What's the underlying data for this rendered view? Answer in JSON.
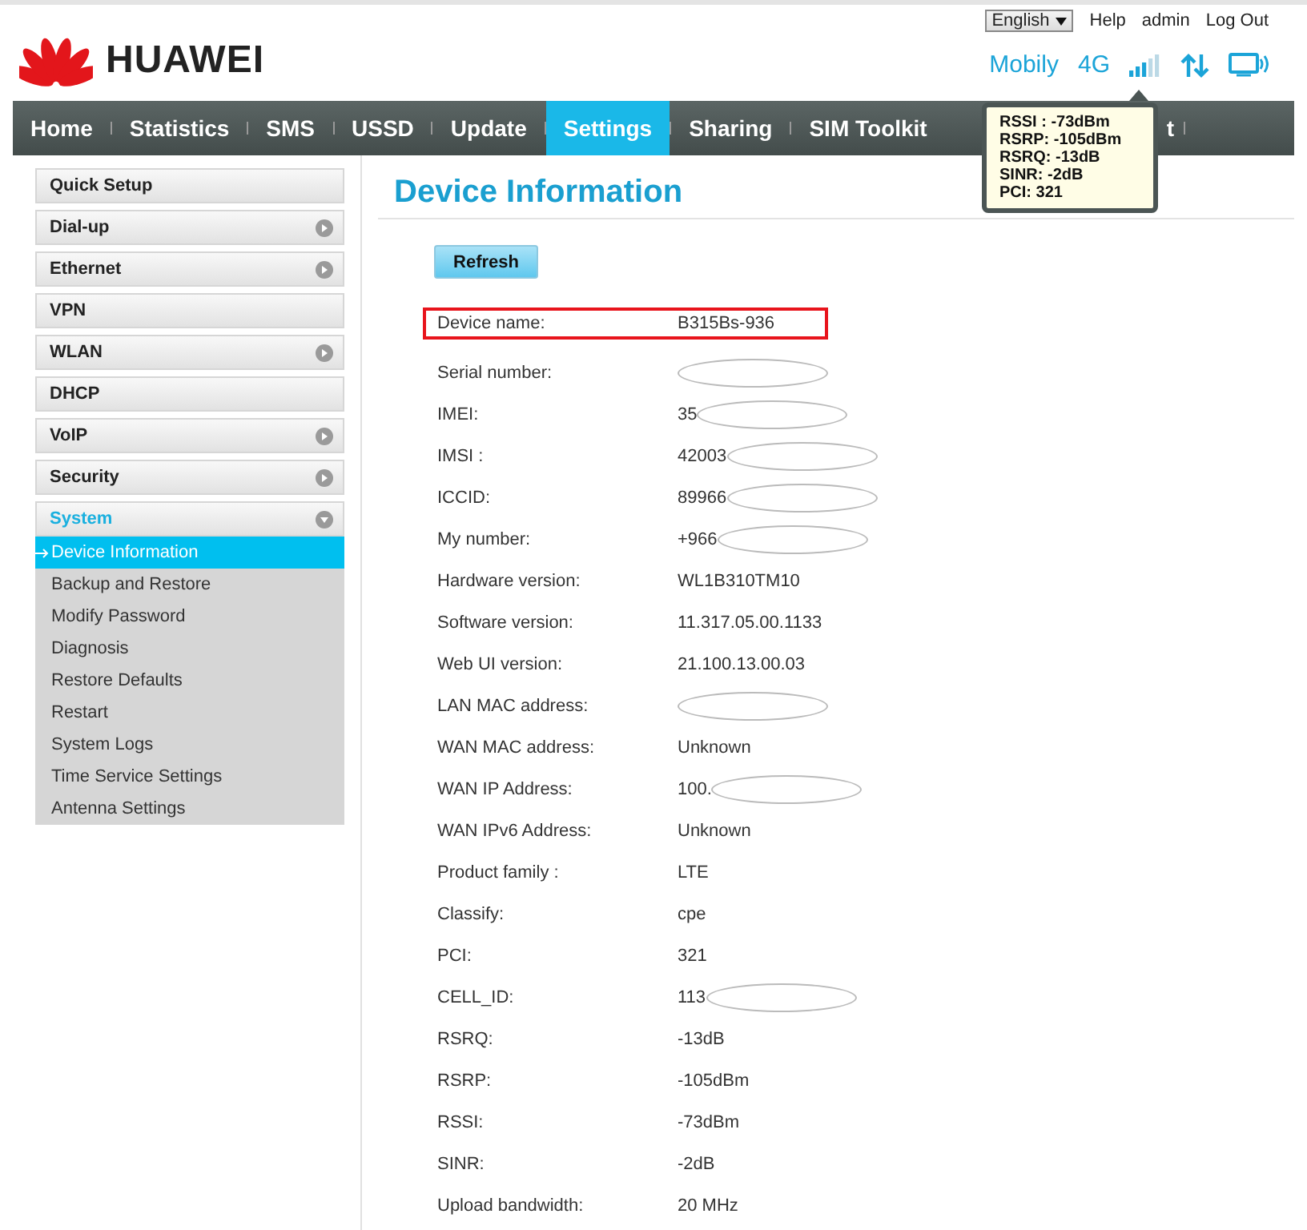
{
  "header": {
    "logo": "HUAWEI",
    "language": "English",
    "links": [
      "Help",
      "admin",
      "Log Out"
    ],
    "operator": "Mobily",
    "network": "4G"
  },
  "nav": [
    {
      "label": "Home",
      "selected": false
    },
    {
      "label": "Statistics",
      "selected": false
    },
    {
      "label": "SMS",
      "selected": false
    },
    {
      "label": "USSD",
      "selected": false
    },
    {
      "label": "Update",
      "selected": false
    },
    {
      "label": "Settings",
      "selected": true
    },
    {
      "label": "Sharing",
      "selected": false
    },
    {
      "label": "SIM Toolkit",
      "selected": false
    },
    {
      "label": "t",
      "selected": false
    }
  ],
  "signal_tooltip": [
    "RSSI : -73dBm",
    "RSRP: -105dBm",
    "RSRQ: -13dB",
    "SINR: -2dB",
    "PCI: 321"
  ],
  "sidebar": [
    {
      "label": "Quick Setup",
      "expandable": false,
      "expanded": false
    },
    {
      "label": "Dial-up",
      "expandable": true,
      "expanded": false
    },
    {
      "label": "Ethernet",
      "expandable": true,
      "expanded": false
    },
    {
      "label": "VPN",
      "expandable": false,
      "expanded": false
    },
    {
      "label": "WLAN",
      "expandable": true,
      "expanded": false
    },
    {
      "label": "DHCP",
      "expandable": false,
      "expanded": false
    },
    {
      "label": "VoIP",
      "expandable": true,
      "expanded": false
    },
    {
      "label": "Security",
      "expandable": true,
      "expanded": false
    },
    {
      "label": "System",
      "expandable": true,
      "expanded": true,
      "children": [
        {
          "label": "Device Information",
          "selected": true
        },
        {
          "label": "Backup and Restore",
          "selected": false
        },
        {
          "label": "Modify Password",
          "selected": false
        },
        {
          "label": "Diagnosis",
          "selected": false
        },
        {
          "label": "Restore Defaults",
          "selected": false
        },
        {
          "label": "Restart",
          "selected": false
        },
        {
          "label": "System Logs",
          "selected": false
        },
        {
          "label": "Time Service Settings",
          "selected": false
        },
        {
          "label": "Antenna Settings",
          "selected": false
        }
      ]
    }
  ],
  "page": {
    "title": "Device Information",
    "refresh_button": "Refresh",
    "rows": [
      {
        "label": "Device name:",
        "value": "B315Bs-936",
        "highlighted": true,
        "redacted": false
      },
      {
        "label": "Serial number:",
        "redacted": true,
        "highlighted": false
      },
      {
        "label": "IMEI:",
        "value": "35",
        "redacted": true,
        "highlighted": false
      },
      {
        "label": "IMSI :",
        "value": "42003",
        "redacted": true,
        "highlighted": false
      },
      {
        "label": "ICCID:",
        "value": "89966",
        "redacted": true,
        "highlighted": false
      },
      {
        "label": "My number:",
        "value": "+966",
        "redacted": true,
        "highlighted": false
      },
      {
        "label": "Hardware version:",
        "value": "WL1B310TM10",
        "redacted": false,
        "highlighted": false
      },
      {
        "label": "Software version:",
        "value": "11.317.05.00.1133",
        "redacted": false,
        "highlighted": false
      },
      {
        "label": "Web UI version:",
        "value": "21.100.13.00.03",
        "redacted": false,
        "highlighted": false
      },
      {
        "label": "LAN MAC address:",
        "redacted": true,
        "highlighted": false
      },
      {
        "label": "WAN MAC address:",
        "value": "Unknown",
        "redacted": false,
        "highlighted": false
      },
      {
        "label": "WAN IP Address:",
        "value": "100.",
        "redacted": true,
        "highlighted": false
      },
      {
        "label": "WAN IPv6 Address:",
        "value": "Unknown",
        "redacted": false,
        "highlighted": false
      },
      {
        "label": "Product family :",
        "value": "LTE",
        "redacted": false,
        "highlighted": false
      },
      {
        "label": "Classify:",
        "value": "cpe",
        "redacted": false,
        "highlighted": false
      },
      {
        "label": "PCI:",
        "value": "321",
        "redacted": false,
        "highlighted": false
      },
      {
        "label": "CELL_ID:",
        "value": "113",
        "redacted": true,
        "highlighted": false
      },
      {
        "label": "RSRQ:",
        "value": "-13dB",
        "redacted": false,
        "highlighted": false
      },
      {
        "label": "RSRP:",
        "value": "-105dBm",
        "redacted": false,
        "highlighted": false
      },
      {
        "label": "RSSI:",
        "value": "-73dBm",
        "redacted": false,
        "highlighted": false
      },
      {
        "label": "SINR:",
        "value": "-2dB",
        "redacted": false,
        "highlighted": false
      },
      {
        "label": "Upload bandwidth:",
        "value": "20 MHz",
        "redacted": false,
        "highlighted": false
      }
    ]
  }
}
